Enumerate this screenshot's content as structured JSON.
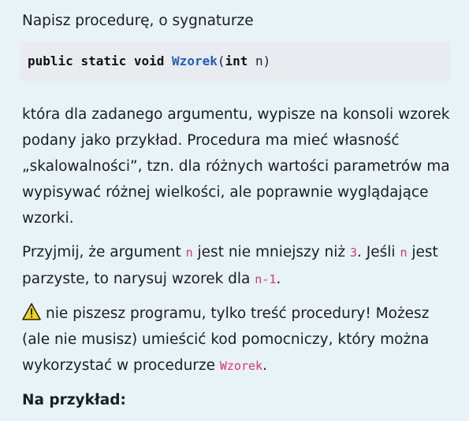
{
  "intro": "Napisz procedurę, o sygnaturze",
  "signature": {
    "kw1": "public",
    "kw2": "static",
    "kw3": "void",
    "name": "Wzorek",
    "open": "(",
    "type": "int",
    "param": "n",
    "close": ")"
  },
  "p1": "która dla zadanego argumentu, wypisze na konsoli wzorek podany jako przykład. Procedura ma mieć własność „skalowalności”, tzn. dla różnych wartości parametrów ma wypisywać różnej wielkości, ale poprawnie wyglądające wzorki.",
  "p2": {
    "t1": "Przyjmij, że argument ",
    "c1": "n",
    "t2": " jest nie mniejszy niż ",
    "c2": "3",
    "t3": ". Jeśli ",
    "c3": "n",
    "t4": " jest parzyste, to narysuj wzorek dla ",
    "c4": "n-1",
    "t5": "."
  },
  "p3": {
    "icon": "warning-icon",
    "t1": "nie piszesz programu, tylko treść procedury! Możesz (ale nie musisz) umieścić kod pomocniczy, który można wykorzystać w procedurze ",
    "c1": "Wzorek",
    "t2": "."
  },
  "example_heading": "Na przykład:"
}
